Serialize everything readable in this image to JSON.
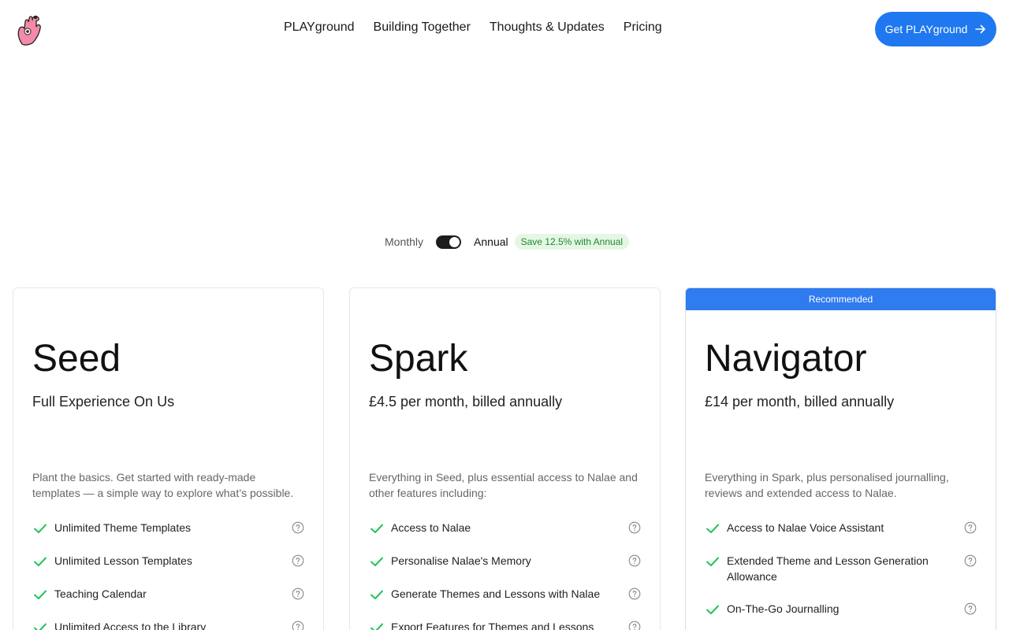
{
  "header": {
    "logo_icon": "hand-mascot-icon",
    "nav": [
      {
        "label": "PLAYground"
      },
      {
        "label": "Building Together"
      },
      {
        "label": "Thoughts & Updates"
      },
      {
        "label": "Pricing"
      }
    ],
    "cta_label": "Get PLAYground",
    "cta_icon": "arrow-right-icon"
  },
  "billing": {
    "monthly_label": "Monthly",
    "annual_label": "Annual",
    "selected": "Annual",
    "save_badge": "Save 12.5% with Annual"
  },
  "colors": {
    "accent": "#1f78f0",
    "check": "#22c55e",
    "badge_bg": "#e6f6e4",
    "badge_text": "#1d8a2e"
  },
  "plans": [
    {
      "name": "Seed",
      "price": "Full Experience On Us",
      "description": "Plant the basics. Get started with ready-made templates — a simple way to explore what’s possible.",
      "features": [
        "Unlimited Theme Templates",
        "Unlimited Lesson Templates",
        "Teaching Calendar",
        "Unlimited Access to the Library"
      ]
    },
    {
      "name": "Spark",
      "price": "£4.5 per month, billed annually",
      "description": "Everything in Seed, plus essential access to Nalae and other features including:",
      "features": [
        "Access to Nalae",
        "Personalise Nalae's Memory",
        "Generate Themes and Lessons with Nalae",
        "Export Features for Themes and Lessons"
      ]
    },
    {
      "badge": "Recommended",
      "name": "Navigator",
      "price": "£14 per month, billed annually",
      "description": "Everything in Spark, plus personalised journalling, reviews and extended access to Nalae.",
      "features": [
        "Access to Nalae Voice Assistant",
        "Extended Theme and Lesson Generation Allowance",
        "On-The-Go Journalling"
      ]
    }
  ]
}
